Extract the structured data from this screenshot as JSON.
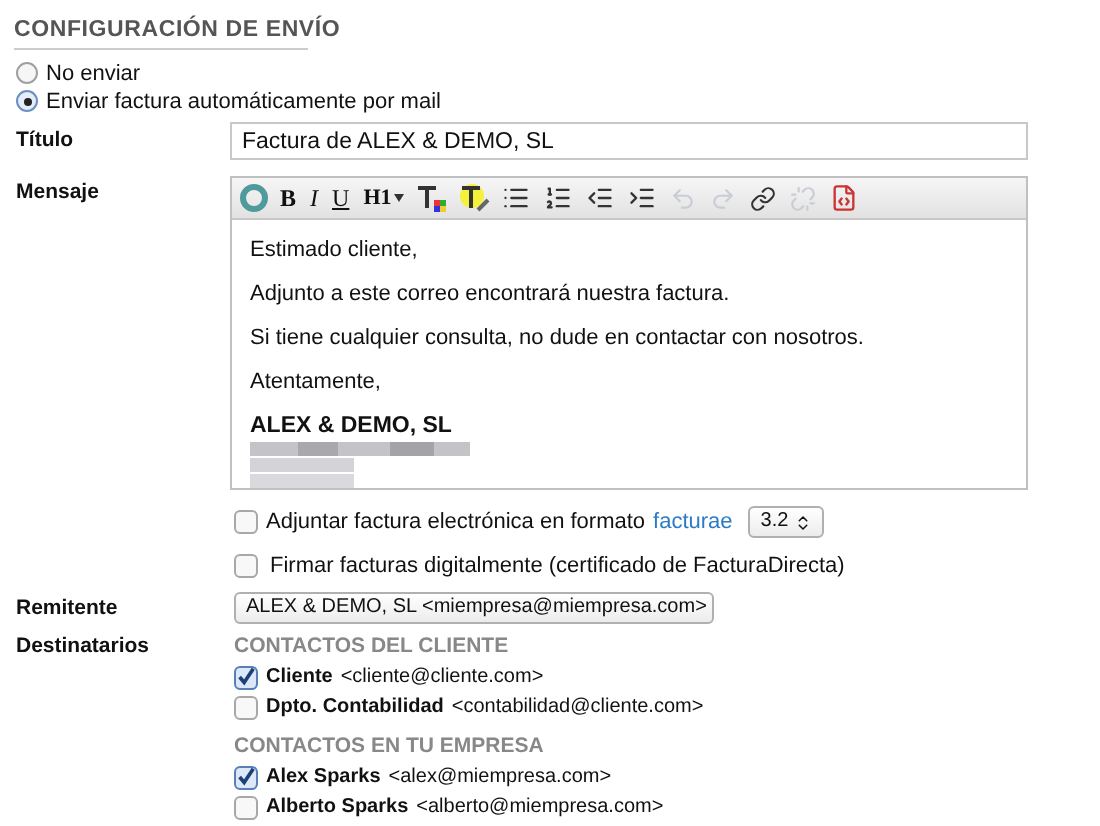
{
  "section_title": "CONFIGURACIÓN DE ENVÍO",
  "send_options": [
    {
      "label": "No enviar",
      "selected": false
    },
    {
      "label": "Enviar factura automáticamente por mail",
      "selected": true
    }
  ],
  "title_field": {
    "label": "Título",
    "value": "Factura de ALEX & DEMO, SL"
  },
  "message": {
    "label": "Mensaje",
    "toolbar": {
      "bold": "B",
      "italic": "I",
      "underline": "U",
      "heading": "H1",
      "undo": {
        "disabled": true
      },
      "redo": {
        "disabled": true
      },
      "unlink": {
        "disabled": true
      }
    },
    "paragraphs": [
      {
        "kind": "text",
        "text": "Estimado cliente,"
      },
      {
        "kind": "text",
        "text": "Adjunto a este correo encontrará nuestra factura."
      },
      {
        "kind": "text",
        "text": "Si tiene cualquier consulta, no dude en contactar con nosotros."
      },
      {
        "kind": "text",
        "text": "Atentamente,"
      },
      {
        "kind": "signature",
        "text": "ALEX & DEMO, SL"
      }
    ]
  },
  "attach_option": {
    "label": "Adjuntar factura electrónica en formato",
    "link": "facturae",
    "checked": false,
    "version": "3.2"
  },
  "sign_option": {
    "label": "Firmar facturas digitalmente (certificado de FacturaDirecta)",
    "checked": false
  },
  "sender": {
    "label": "Remitente",
    "value": "ALEX & DEMO, SL <miempresa@miempresa.com>"
  },
  "recipients": {
    "label": "Destinatarios",
    "groups": [
      {
        "title": "CONTACTOS DEL CLIENTE",
        "contacts": [
          {
            "name": "Cliente",
            "email": "<cliente@cliente.com>",
            "checked": true
          },
          {
            "name": "Dpto. Contabilidad",
            "email": "<contabilidad@cliente.com>",
            "checked": false
          }
        ]
      },
      {
        "title": "CONTACTOS EN TU EMPRESA",
        "contacts": [
          {
            "name": "Alex Sparks",
            "email": "<alex@miempresa.com>",
            "checked": true
          },
          {
            "name": "Alberto Sparks",
            "email": "<alberto@miempresa.com>",
            "checked": false
          }
        ]
      }
    ]
  }
}
